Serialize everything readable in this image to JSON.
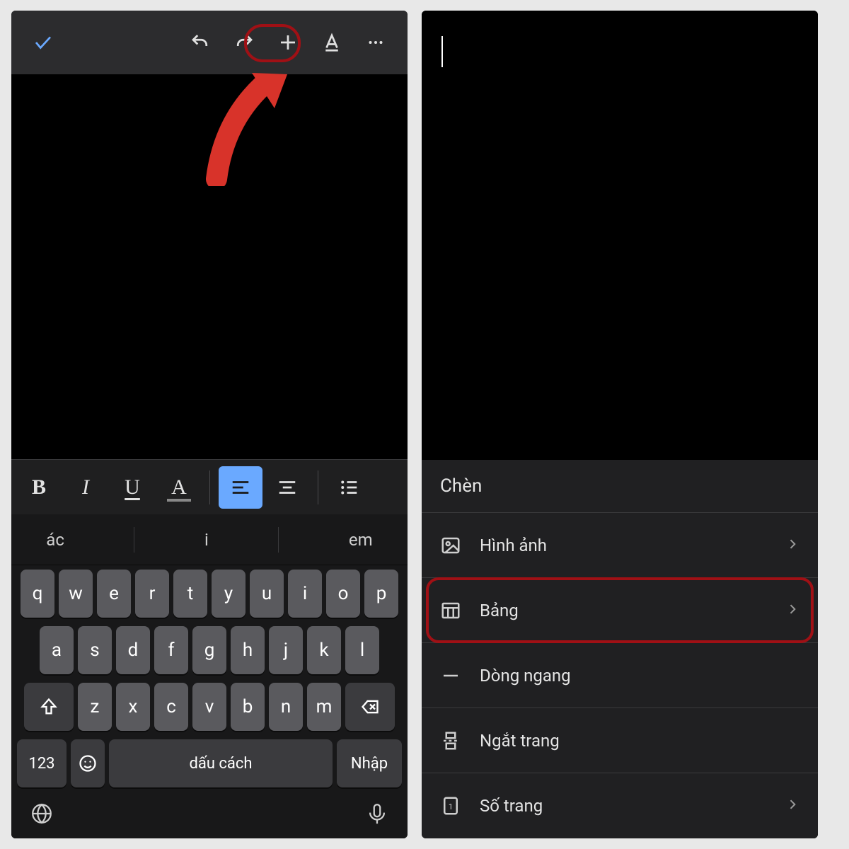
{
  "left": {
    "toolbar": {
      "accept_icon": "check-icon",
      "undo_icon": "undo-icon",
      "redo_icon": "redo-icon",
      "insert_icon": "plus-icon",
      "textformat_icon": "text-format-icon",
      "more_icon": "more-icon"
    },
    "format_bar": {
      "bold_label": "B",
      "italic_label": "I",
      "underline_label": "U",
      "textcolor_label": "A"
    },
    "keyboard": {
      "suggestions": [
        "ác",
        "i",
        "em"
      ],
      "row1": [
        "q",
        "w",
        "e",
        "r",
        "t",
        "y",
        "u",
        "i",
        "o",
        "p"
      ],
      "row2": [
        "a",
        "s",
        "d",
        "f",
        "g",
        "h",
        "j",
        "k",
        "l"
      ],
      "row3": [
        "z",
        "x",
        "c",
        "v",
        "b",
        "n",
        "m"
      ],
      "numbers_label": "123",
      "space_label": "dấu cách",
      "enter_label": "Nhập"
    }
  },
  "right": {
    "insert_panel": {
      "header": "Chèn",
      "items": [
        {
          "icon": "image-icon",
          "label": "Hình ảnh",
          "chevron": true,
          "highlight": false
        },
        {
          "icon": "table-icon",
          "label": "Bảng",
          "chevron": true,
          "highlight": true
        },
        {
          "icon": "hr-icon",
          "label": "Dòng ngang",
          "chevron": false,
          "highlight": false
        },
        {
          "icon": "page-break-icon",
          "label": "Ngắt trang",
          "chevron": false,
          "highlight": false
        },
        {
          "icon": "page-number-icon",
          "label": "Số trang",
          "chevron": true,
          "highlight": false
        }
      ]
    }
  },
  "colors": {
    "annotation_red": "#a01015",
    "accent_blue": "#6aa9ff"
  }
}
